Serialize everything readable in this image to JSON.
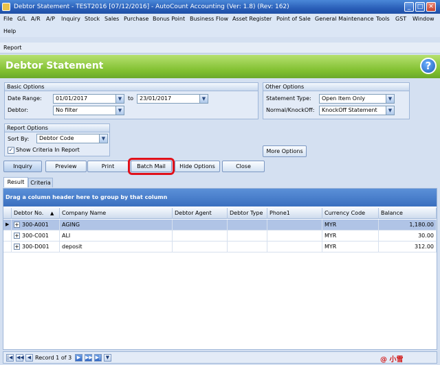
{
  "window": {
    "title": "Debtor Statement - TEST2016 [07/12/2016] - AutoCount Accounting (Ver: 1.8) (Rev: 162)"
  },
  "menu": [
    "File",
    "G/L",
    "A/R",
    "A/P",
    "Inquiry",
    "Stock",
    "Sales",
    "Purchase",
    "Bonus Point",
    "Business Flow",
    "Asset Register",
    "Point of Sale",
    "General Maintenance",
    "Tools",
    "GST",
    "Window",
    "Help"
  ],
  "report_label": "Report",
  "page_title": "Debtor Statement",
  "basic_options": {
    "title": "Basic Options",
    "date_range_label": "Date Range:",
    "date_from": "01/01/2017",
    "to_label": "to",
    "date_to": "23/01/2017",
    "debtor_label": "Debtor:",
    "debtor_value": "No filter"
  },
  "other_options": {
    "title": "Other Options",
    "statement_type_label": "Statement Type:",
    "statement_type_value": "Open Item Only",
    "knockoff_label": "Normal/KnockOff:",
    "knockoff_value": "KnockOff Statement"
  },
  "report_options": {
    "title": "Report Options",
    "sort_by_label": "Sort By:",
    "sort_by_value": "Debtor Code",
    "show_criteria_label": "Show Criteria In Report",
    "show_criteria_checked": true
  },
  "buttons": {
    "more_options": "More Options",
    "inquiry": "Inquiry",
    "preview": "Preview",
    "print": "Print",
    "batch_mail": "Batch Mail",
    "hide_options": "Hide Options",
    "close": "Close"
  },
  "tabs": [
    "Result",
    "Criteria"
  ],
  "grid": {
    "group_hint": "Drag a column header here to group by that column",
    "columns": [
      "Debtor No.",
      "Company Name",
      "Debtor Agent",
      "Debtor Type",
      "Phone1",
      "Currency Code",
      "Balance"
    ],
    "rows": [
      {
        "debtor_no": "300-A001",
        "company": "AGING",
        "agent": "",
        "type": "",
        "phone": "",
        "currency": "MYR",
        "balance": "1,180.00"
      },
      {
        "debtor_no": "300-C001",
        "company": "ALI",
        "agent": "",
        "type": "",
        "phone": "",
        "currency": "MYR",
        "balance": "30.00"
      },
      {
        "debtor_no": "300-D001",
        "company": "deposit",
        "agent": "",
        "type": "",
        "phone": "",
        "currency": "MYR",
        "balance": "312.00"
      }
    ]
  },
  "navigator": {
    "record_text": "Record 1 of 3"
  },
  "watermark": "@ 小雪"
}
